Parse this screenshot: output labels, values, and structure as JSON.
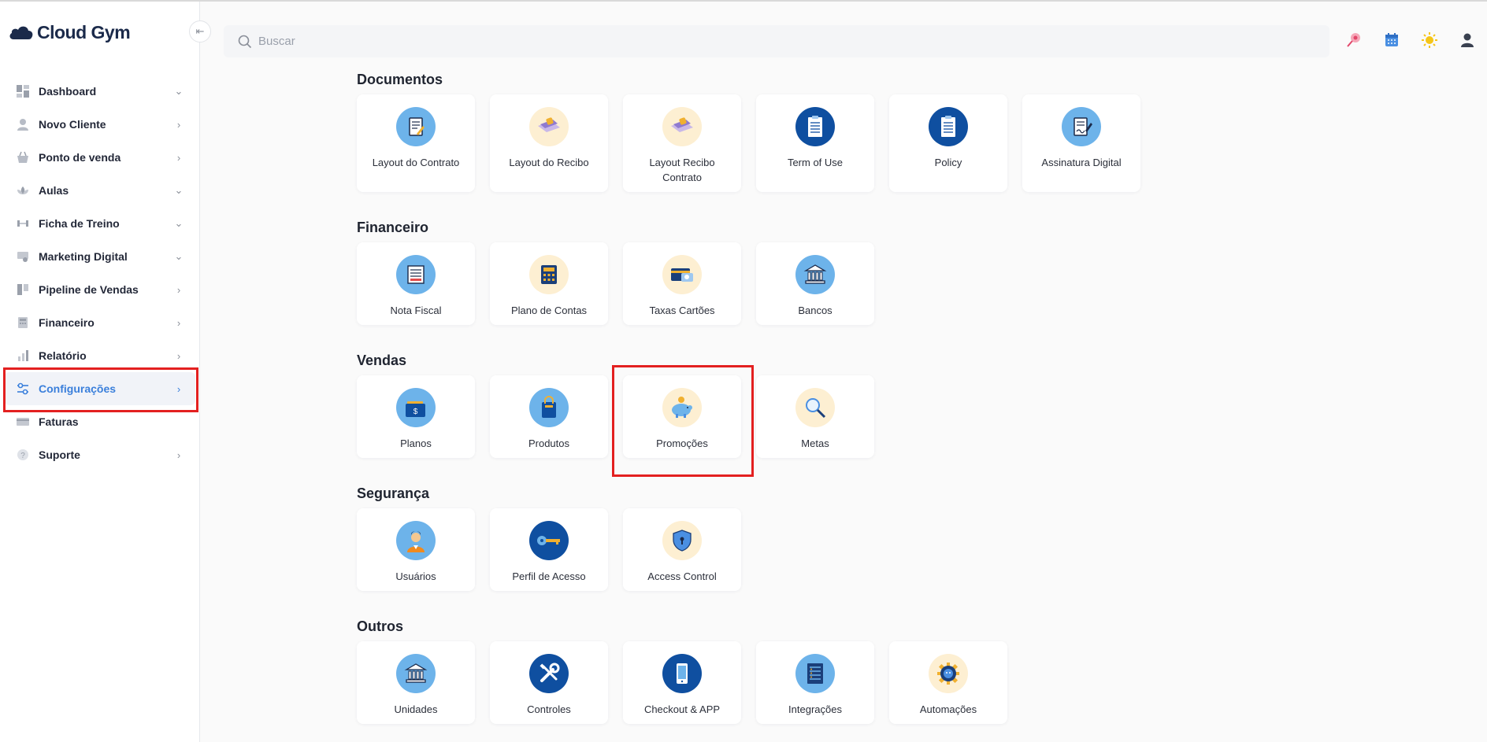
{
  "app": {
    "logo": "Cloud Gym"
  },
  "search": {
    "placeholder": "Buscar"
  },
  "sidebar": {
    "items": [
      {
        "label": "Dashboard",
        "icon": "dashboard-icon",
        "chevron": "down"
      },
      {
        "label": "Novo Cliente",
        "icon": "user-icon",
        "chevron": "right"
      },
      {
        "label": "Ponto de venda",
        "icon": "basket-icon",
        "chevron": "right"
      },
      {
        "label": "Aulas",
        "icon": "lotus-icon",
        "chevron": "down"
      },
      {
        "label": "Ficha de Treino",
        "icon": "dumbbell-icon",
        "chevron": "down"
      },
      {
        "label": "Marketing Digital",
        "icon": "marketing-icon",
        "chevron": "down"
      },
      {
        "label": "Pipeline de Vendas",
        "icon": "pipeline-icon",
        "chevron": "right"
      },
      {
        "label": "Financeiro",
        "icon": "calculator-icon",
        "chevron": "right"
      },
      {
        "label": "Relatório",
        "icon": "chart-icon",
        "chevron": "right"
      },
      {
        "label": "Configurações",
        "icon": "sliders-icon",
        "chevron": "right",
        "active": true
      },
      {
        "label": "Faturas",
        "icon": "card-icon",
        "chevron": ""
      },
      {
        "label": "Suporte",
        "icon": "help-icon",
        "chevron": "right"
      }
    ]
  },
  "sections": [
    {
      "title": "Documentos",
      "items": [
        {
          "label": "Layout do Contrato",
          "icon": "contract-icon"
        },
        {
          "label": "Layout do Recibo",
          "icon": "receipt-icon"
        },
        {
          "label": "Layout Recibo Contrato",
          "icon": "receipt-contract-icon"
        },
        {
          "label": "Term of Use",
          "icon": "terms-icon"
        },
        {
          "label": "Policy",
          "icon": "policy-icon"
        },
        {
          "label": "Assinatura Digital",
          "icon": "signature-icon"
        }
      ]
    },
    {
      "title": "Financeiro",
      "items": [
        {
          "label": "Nota Fiscal",
          "icon": "invoice-icon"
        },
        {
          "label": "Plano de Contas",
          "icon": "calculator-icon"
        },
        {
          "label": "Taxas Cartões",
          "icon": "credit-card-icon"
        },
        {
          "label": "Bancos",
          "icon": "bank-icon"
        }
      ]
    },
    {
      "title": "Vendas",
      "items": [
        {
          "label": "Planos",
          "icon": "wallet-icon"
        },
        {
          "label": "Produtos",
          "icon": "shopping-bag-icon"
        },
        {
          "label": "Promoções",
          "icon": "piggy-bank-icon"
        },
        {
          "label": "Metas",
          "icon": "magnifier-icon"
        }
      ]
    },
    {
      "title": "Segurança",
      "items": [
        {
          "label": "Usuários",
          "icon": "person-icon"
        },
        {
          "label": "Perfil de Acesso",
          "icon": "key-icon"
        },
        {
          "label": "Access Control",
          "icon": "shield-icon"
        }
      ]
    },
    {
      "title": "Outros",
      "items": [
        {
          "label": "Unidades",
          "icon": "building-icon"
        },
        {
          "label": "Controles",
          "icon": "tools-icon"
        },
        {
          "label": "Checkout & APP",
          "icon": "phone-icon"
        },
        {
          "label": "Integrações",
          "icon": "server-icon"
        },
        {
          "label": "Automações",
          "icon": "gear-robot-icon"
        }
      ]
    }
  ],
  "colors": {
    "accent": "#3a7fdb",
    "highlight": "#e32020",
    "icon_blue": "#6db3ea",
    "icon_dark": "#0f4fa0",
    "icon_cream": "#fdefd2"
  }
}
